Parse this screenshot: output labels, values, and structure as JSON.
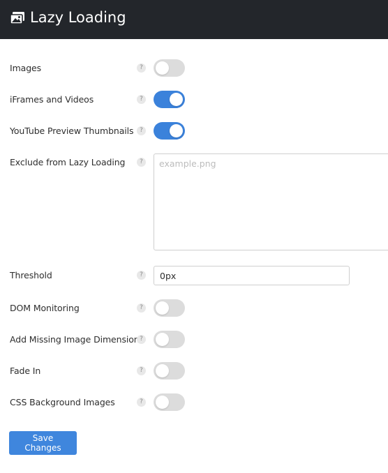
{
  "header": {
    "title": "Lazy Loading",
    "icon": "images-icon"
  },
  "settings": {
    "images": {
      "label": "Images",
      "enabled": false
    },
    "iframes": {
      "label": "iFrames and Videos",
      "enabled": true
    },
    "youtube": {
      "label": "YouTube Preview Thumbnails",
      "enabled": true
    },
    "exclude": {
      "label": "Exclude from Lazy Loading",
      "placeholder": "example.png",
      "value": ""
    },
    "threshold": {
      "label": "Threshold",
      "value": "0px"
    },
    "dom_monitoring": {
      "label": "DOM Monitoring",
      "enabled": false
    },
    "missing_dimensions": {
      "label": "Add Missing Image Dimensions",
      "enabled": false
    },
    "fade_in": {
      "label": "Fade In",
      "enabled": false
    },
    "css_backgrounds": {
      "label": "CSS Background Images",
      "enabled": false
    }
  },
  "help_glyph": "?",
  "save_label": "Save Changes",
  "colors": {
    "accent": "#3b82db",
    "header_bg": "#23262b",
    "toggle_off": "#dcdcdc"
  }
}
